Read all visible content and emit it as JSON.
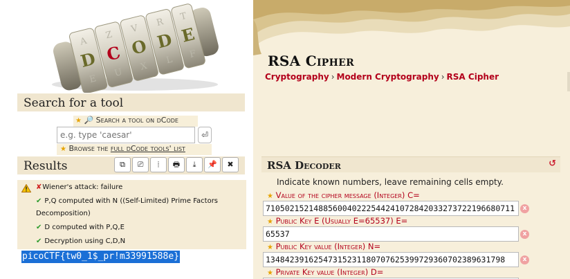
{
  "logo": {
    "letters": "DCODE"
  },
  "search": {
    "title": "Search for a tool",
    "link_label": "Search a tool on dCode",
    "placeholder": "e.g. type 'caesar'",
    "go_label": "⏎",
    "browse_prefix": "Browse the ",
    "browse_link": "full dCode tools' list"
  },
  "results": {
    "title": "Results",
    "toolbar": [
      "⧉",
      "⎚",
      "⦙",
      "🖶",
      "⤓",
      "📌",
      "✖"
    ],
    "lines": [
      {
        "status": "✘",
        "text": "Wiener's attack: failure"
      },
      {
        "status": "✔",
        "text": "P,Q computed with N ((Self-Limited) Prime Factors"
      },
      {
        "status": "",
        "text": "Decomposition)"
      },
      {
        "status": "✔",
        "text": "D computed with P,Q,E"
      },
      {
        "status": "✔",
        "text": "Decryption using C,D,N"
      }
    ],
    "output": "picoCTF{tw0_1$_pr!m33991588e}"
  },
  "page": {
    "title": "RSA Cipher",
    "breadcrumb": [
      "Cryptography",
      "Modern Cryptography",
      "RSA Cipher"
    ],
    "breadcrumb_sep": "›"
  },
  "decoder": {
    "title": "RSA Decoder",
    "instruction": "Indicate known numbers, leave remaining cells empty.",
    "fields": [
      {
        "label": "Value of the cipher message (Integer) C=",
        "value": "7105021521488560040222544241072842033273722196680711"
      },
      {
        "label": "Public Key E (Usually E=65537) E=",
        "value": "65537"
      },
      {
        "label": "Public Key value (Integer) N=",
        "value": "13484239162547315231180707625399729360702389631798"
      },
      {
        "label": "Private Key value (Integer) D=",
        "value": ""
      }
    ],
    "clear_label": "x"
  },
  "colors": {
    "accent_red": "#b3001b",
    "star": "#e6a300",
    "ok_green": "#2a9a2a",
    "selection_blue": "#1a6fd6",
    "panel_beige": "#f0e6cf"
  }
}
